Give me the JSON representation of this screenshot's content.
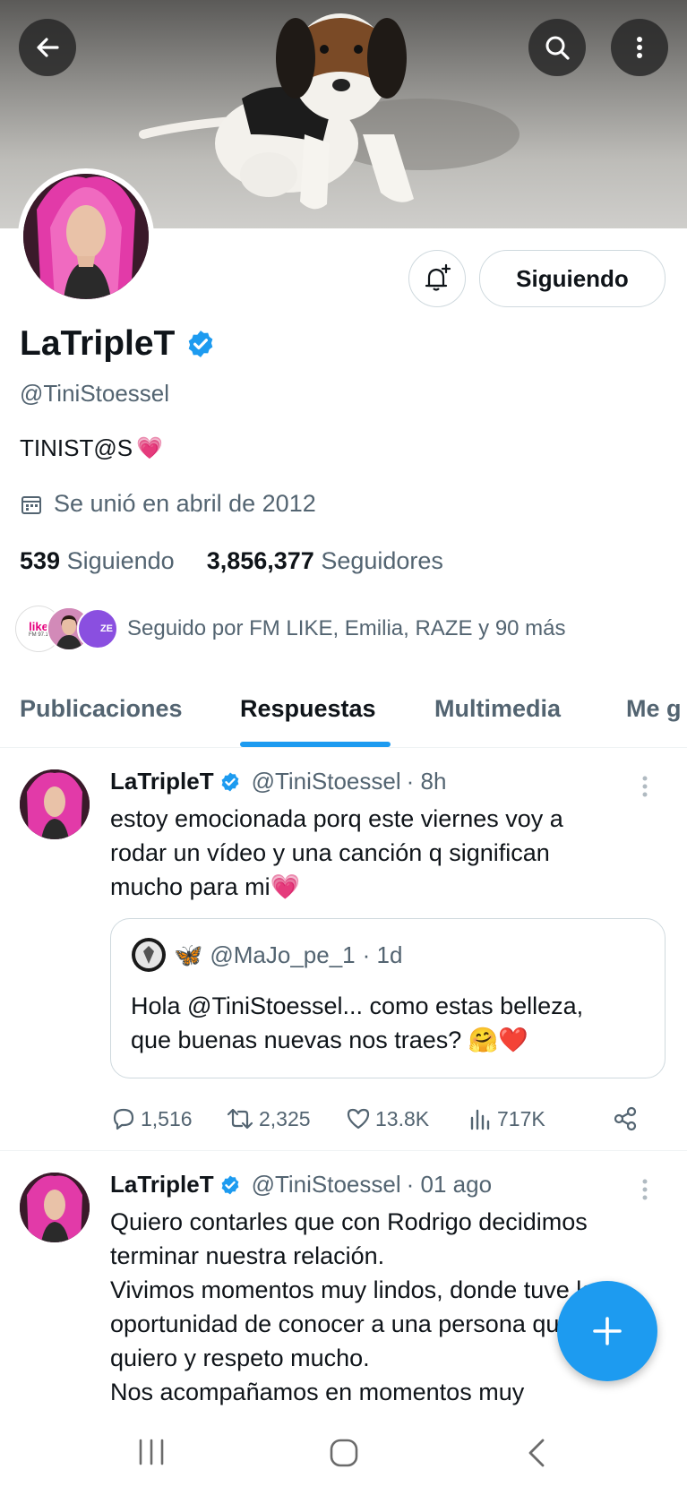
{
  "header": {
    "back_icon": "arrow-left-icon",
    "search_icon": "search-icon",
    "more_icon": "more-vertical-icon"
  },
  "profile": {
    "display_name": "LaTripleT",
    "handle": "@TiniStoessel",
    "bio_text": "TINIST@S",
    "bio_emoji": "💗",
    "joined": "Se unió en abril de 2012",
    "following_count": "539",
    "following_label": "Siguiendo",
    "followers_count": "3,856,377",
    "followers_label": "Seguidores",
    "followed_by": "Seguido por FM LIKE, Emilia, RAZE y 90 más",
    "follow_button": "Siguiendo",
    "verified_color": "#1d9bf0",
    "mini_avatar_1_text": "like",
    "mini_avatar_1_sub": "FM 97.1",
    "mini_avatar_3_text": "ZE"
  },
  "tabs": [
    {
      "label": "Publicaciones"
    },
    {
      "label": "Respuestas"
    },
    {
      "label": "Multimedia"
    },
    {
      "label": "Me g"
    }
  ],
  "posts": [
    {
      "name": "LaTripleT",
      "handle": "@TiniStoessel",
      "time": "· 8h",
      "text_lines": [
        "estoy emocionada porq este viernes voy a",
        "rodar un vídeo y una canción q significan",
        "mucho para mi💗"
      ],
      "quote": {
        "handle": "@MaJo_pe_1",
        "time": "· 1d",
        "butterfly": "🦋",
        "text_lines": [
          "Hola @TiniStoessel... como estas belleza,",
          "que buenas nuevas nos traes? 🤗❤️"
        ]
      },
      "replies": "1,516",
      "reposts": "2,325",
      "likes": "13.8K",
      "views": "717K"
    },
    {
      "name": "LaTripleT",
      "handle": "@TiniStoessel",
      "time": "· 01 ago",
      "text_lines": [
        "Quiero contarles que con Rodrigo decidimos",
        "terminar nuestra relación.",
        "Vivimos momentos muy lindos, donde tuve la",
        "oportunidad de conocer a una persona que",
        "quiero y respeto mucho.",
        "Nos acompañamos en momentos muy"
      ]
    }
  ],
  "fab": {
    "icon": "plus-icon",
    "color": "#1d9bf0"
  },
  "navbar": {
    "recents_icon": "recents-icon",
    "home_icon": "home-icon",
    "back_icon": "back-chevron-icon"
  }
}
